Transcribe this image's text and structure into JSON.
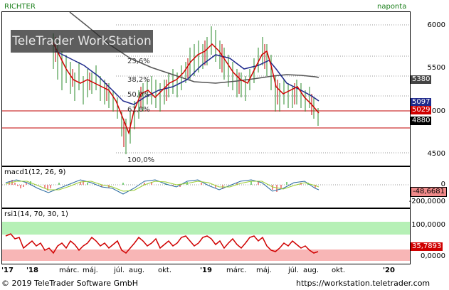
{
  "header": {
    "instrument": "RICHTER",
    "period": "naponta"
  },
  "watermark": "TeleTrader WorkStation",
  "price_panel": {
    "y_ticks": [
      "6000",
      "5500",
      "5000",
      "4500"
    ],
    "tags": [
      {
        "label": "5380",
        "color": "#444444"
      },
      {
        "label": "5097",
        "color": "#1f2a8c"
      },
      {
        "label": "5029",
        "color": "#d00000"
      },
      {
        "label": "4880",
        "color": "#000000"
      }
    ],
    "fib_levels": [
      "23,6%",
      "38,2%",
      "50,0%",
      "61,8%",
      "100,0%"
    ]
  },
  "macd_panel": {
    "title": "macd1(12, 26, 9)",
    "y_ticks": [
      "0",
      "-200,0000"
    ],
    "value_tag": "-48,6681"
  },
  "rsi_panel": {
    "title": "rsi1(14, 70, 30, 1)",
    "y_ticks": [
      "100,0000",
      "0,0000"
    ],
    "value_tag": "35,7893"
  },
  "x_axis": {
    "labels": [
      {
        "text": "'17",
        "bold": true
      },
      {
        "text": "'18",
        "bold": true
      },
      {
        "text": "márc.",
        "bold": false
      },
      {
        "text": "máj.",
        "bold": false
      },
      {
        "text": "júl.",
        "bold": false
      },
      {
        "text": "aug.",
        "bold": false
      },
      {
        "text": "okt.",
        "bold": false
      },
      {
        "text": "'19",
        "bold": true
      },
      {
        "text": "márc.",
        "bold": false
      },
      {
        "text": "máj.",
        "bold": false
      },
      {
        "text": "júl.",
        "bold": false
      },
      {
        "text": "aug.",
        "bold": false
      },
      {
        "text": "okt.",
        "bold": false
      },
      {
        "text": "'20",
        "bold": true
      }
    ]
  },
  "footer": {
    "copyright": "© 2019 TeleTrader Software GmbH",
    "url": "https://workstation.teletrader.com"
  },
  "colors": {
    "price": "#d00000",
    "sma_short": "#1f2a8c",
    "sma_long": "#555555",
    "up_candle": "#2a8a2a",
    "down_candle": "#c00000"
  }
}
